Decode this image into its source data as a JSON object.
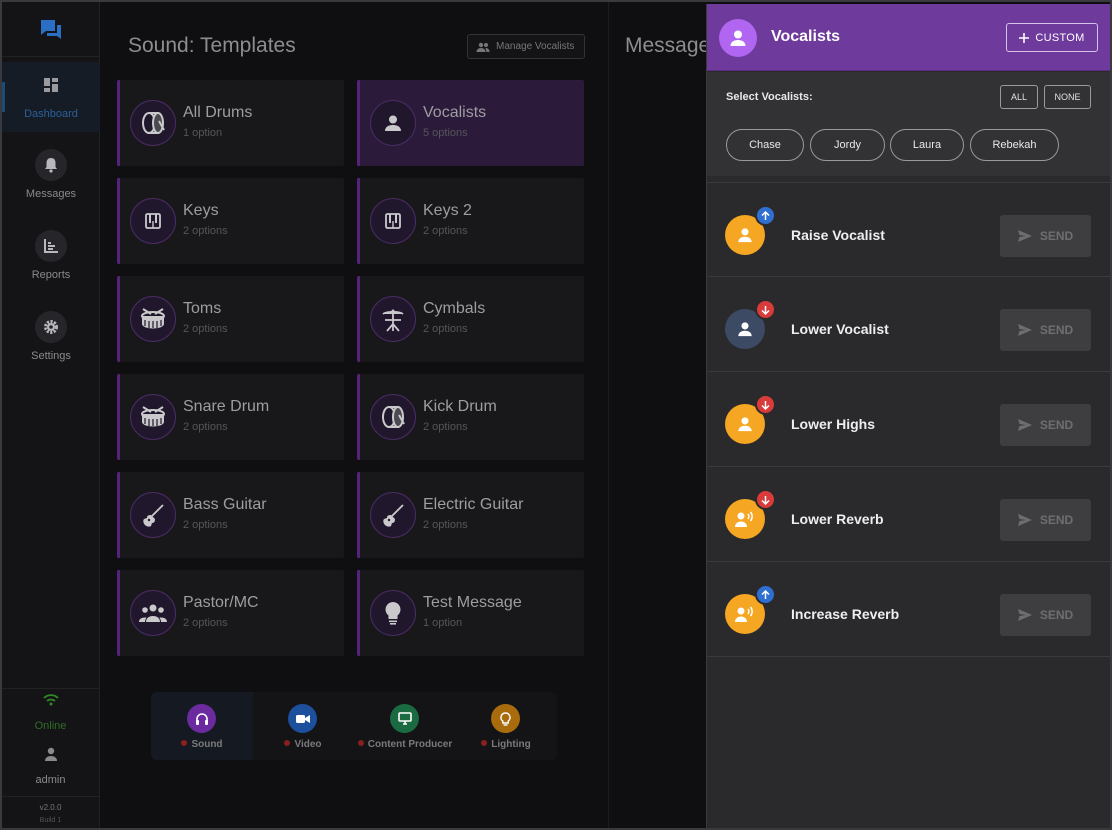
{
  "sidebar": {
    "nav": [
      {
        "label": "Dashboard",
        "icon": "dashboard-icon"
      },
      {
        "label": "Messages",
        "icon": "bell-icon"
      },
      {
        "label": "Reports",
        "icon": "chart-icon"
      },
      {
        "label": "Settings",
        "icon": "gear-icon"
      }
    ],
    "status": "Online",
    "user": "admin",
    "version": "v2.0.0",
    "build": "Build 1"
  },
  "main": {
    "title": "Sound: Templates",
    "manage_label": "Manage Vocalists",
    "cards": [
      {
        "title": "All Drums",
        "sub": "1 option",
        "icon": "bass-drum-icon"
      },
      {
        "title": "Vocalists",
        "sub": "5 options",
        "icon": "person-icon"
      },
      {
        "title": "Keys",
        "sub": "2 options",
        "icon": "piano-icon"
      },
      {
        "title": "Keys 2",
        "sub": "2 options",
        "icon": "piano-icon"
      },
      {
        "title": "Toms",
        "sub": "2 options",
        "icon": "drum-icon"
      },
      {
        "title": "Cymbals",
        "sub": "2 options",
        "icon": "cymbal-icon"
      },
      {
        "title": "Snare Drum",
        "sub": "2 options",
        "icon": "drum-icon"
      },
      {
        "title": "Kick Drum",
        "sub": "2 options",
        "icon": "bass-drum-icon"
      },
      {
        "title": "Bass Guitar",
        "sub": "2 options",
        "icon": "guitar-icon"
      },
      {
        "title": "Electric Guitar",
        "sub": "2 options",
        "icon": "guitar-icon"
      },
      {
        "title": "Pastor/MC",
        "sub": "2 options",
        "icon": "group-icon"
      },
      {
        "title": "Test Message",
        "sub": "1 option",
        "icon": "lightbulb-icon"
      }
    ],
    "departments": [
      {
        "label": "Sound",
        "color": "#7b2fb5"
      },
      {
        "label": "Video",
        "color": "#1e5bb5"
      },
      {
        "label": "Content Producer",
        "color": "#1f7a4a"
      },
      {
        "label": "Lighting",
        "color": "#b8780f"
      }
    ]
  },
  "col2": {
    "title": "Message"
  },
  "panel": {
    "title": "Vocalists",
    "custom_label": "CUSTOM",
    "select_label": "Select Vocalists:",
    "all_label": "ALL",
    "none_label": "NONE",
    "vocalists": [
      "Chase",
      "Jordy",
      "Laura",
      "Rebekah"
    ],
    "send_label": "SEND",
    "messages": [
      {
        "label": "Raise Vocalist",
        "direction": "up",
        "avatar_color": "#f5a623",
        "icon": "person-icon"
      },
      {
        "label": "Lower Vocalist",
        "direction": "down",
        "avatar_color": "#3c4a63",
        "icon": "person-icon"
      },
      {
        "label": "Lower Highs",
        "direction": "down",
        "avatar_color": "#f5a623",
        "icon": "person-icon"
      },
      {
        "label": "Lower Reverb",
        "direction": "down",
        "avatar_color": "#f5a623",
        "icon": "voice-icon"
      },
      {
        "label": "Increase Reverb",
        "direction": "up",
        "avatar_color": "#f5a623",
        "icon": "voice-icon"
      }
    ]
  }
}
